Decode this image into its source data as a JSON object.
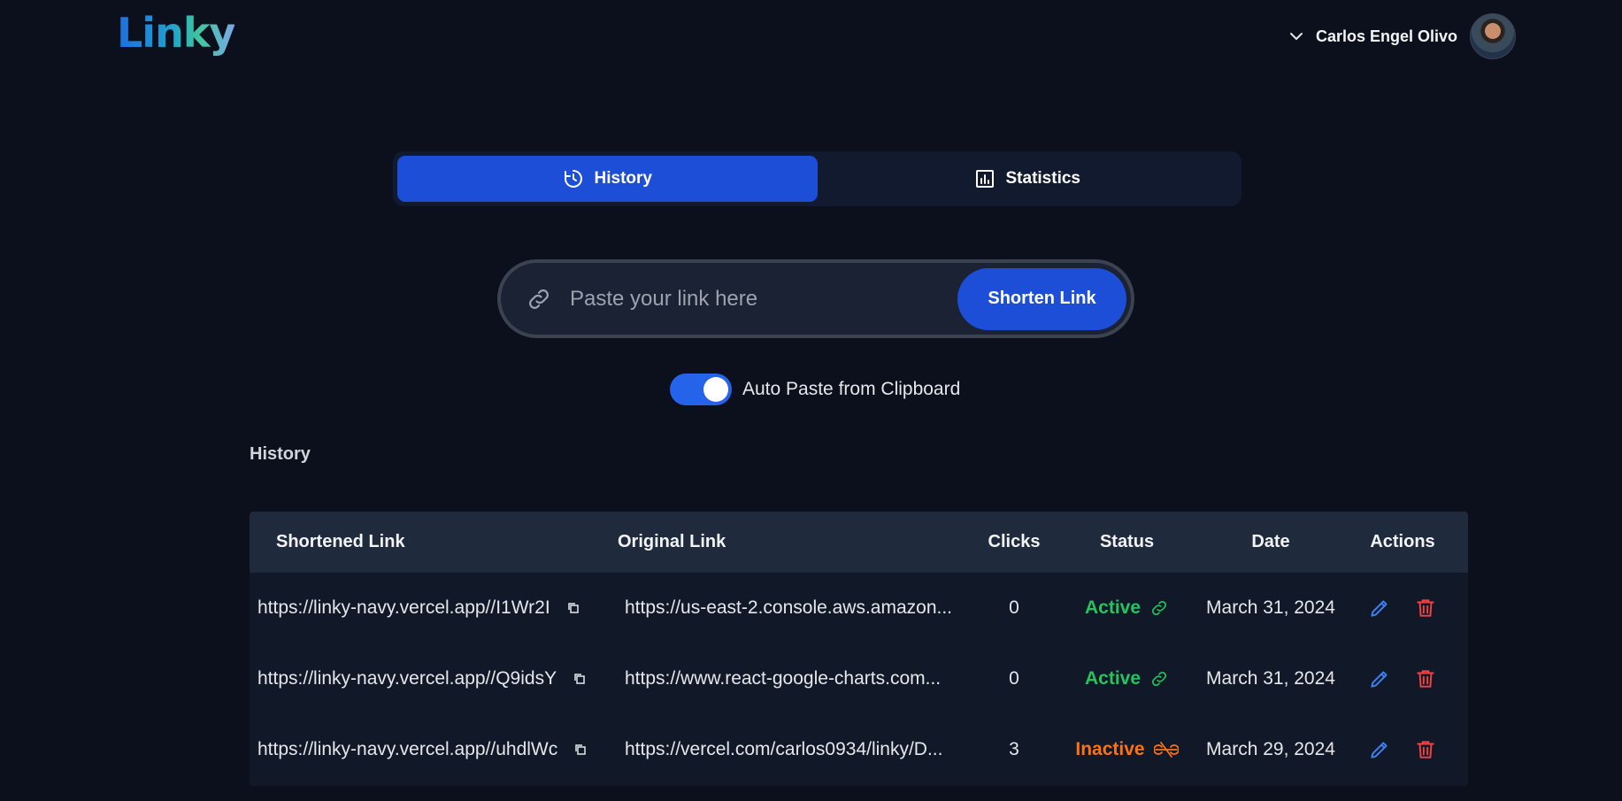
{
  "header": {
    "logo": "Linky",
    "user_name": "Carlos Engel Olivo"
  },
  "tabs": [
    {
      "label": "History",
      "icon": "history-icon",
      "active": true
    },
    {
      "label": "Statistics",
      "icon": "chart-icon",
      "active": false
    }
  ],
  "search": {
    "placeholder": "Paste your link here",
    "value": "",
    "button_label": "Shorten Link"
  },
  "auto_paste": {
    "label": "Auto Paste from Clipboard",
    "enabled": true
  },
  "history": {
    "title": "History",
    "columns": [
      "Shortened Link",
      "Original Link",
      "Clicks",
      "Status",
      "Date",
      "Actions"
    ],
    "rows": [
      {
        "short": "https://linky-navy.vercel.app//I1Wr2I",
        "original": "https://us-east-2.console.aws.amazon...",
        "clicks": "0",
        "status": "Active",
        "date": "March 31, 2024"
      },
      {
        "short": "https://linky-navy.vercel.app//Q9idsY",
        "original": "https://www.react-google-charts.com...",
        "clicks": "0",
        "status": "Active",
        "date": "March 31, 2024"
      },
      {
        "short": "https://linky-navy.vercel.app//uhdlWc",
        "original": "https://vercel.com/carlos0934/linky/D...",
        "clicks": "3",
        "status": "Inactive",
        "date": "March 29, 2024"
      }
    ]
  },
  "colors": {
    "accent": "#1d4ed8",
    "active": "#22c55e",
    "inactive": "#f97316",
    "edit": "#3b82f6",
    "delete": "#ef4444"
  }
}
